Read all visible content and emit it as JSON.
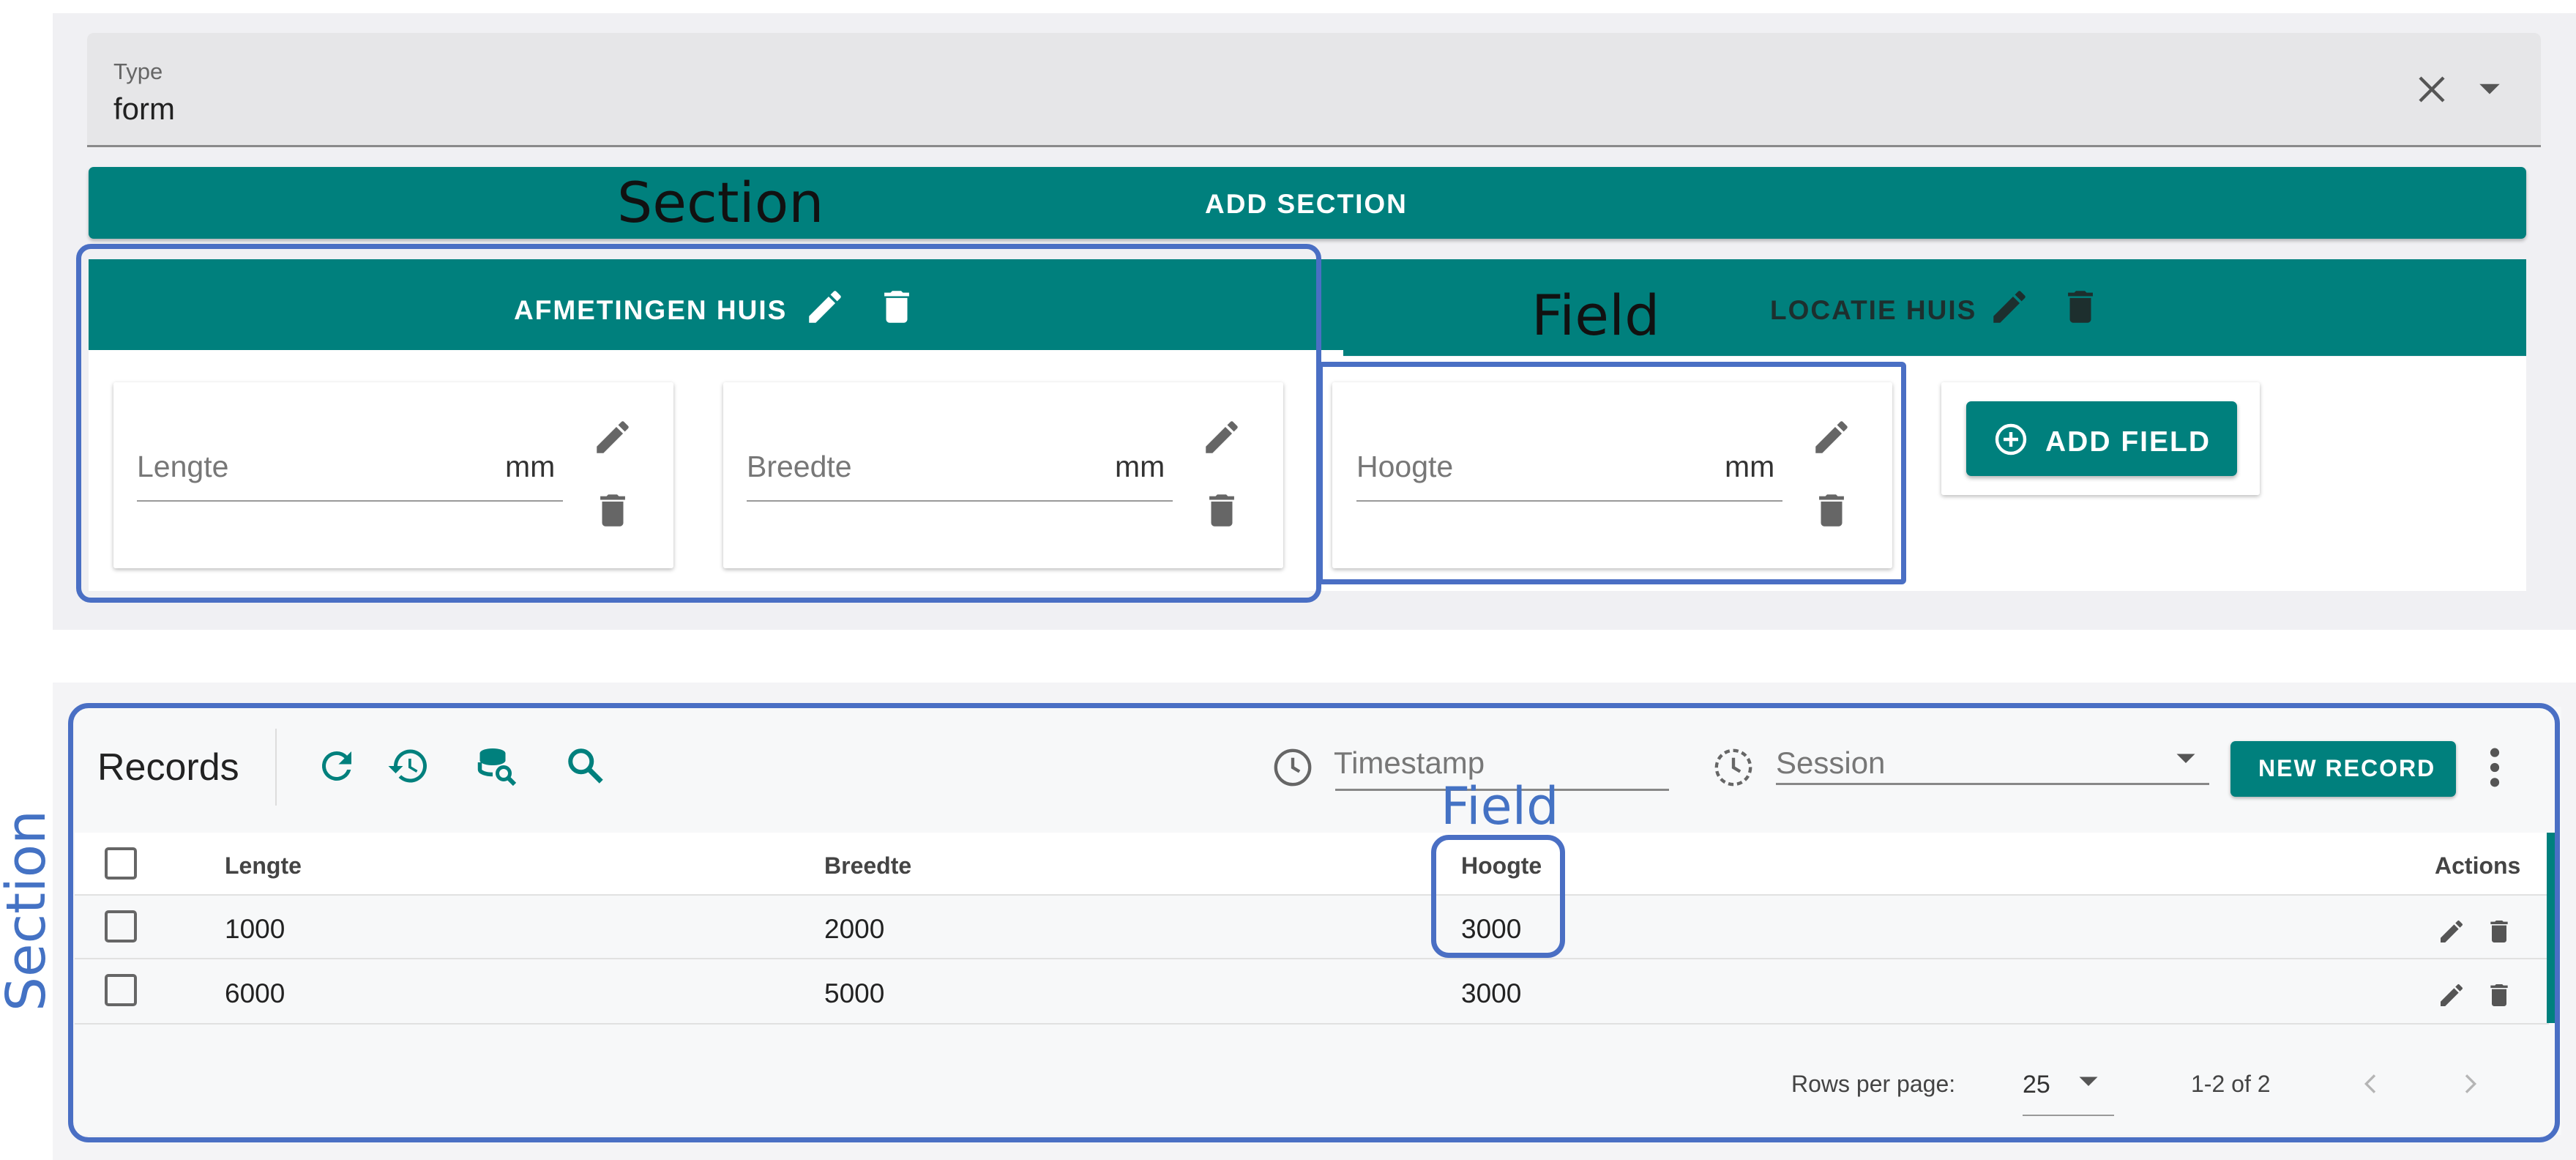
{
  "form_editor": {
    "type_field": {
      "label": "Type",
      "value": "form"
    },
    "add_section_label": "ADD SECTION",
    "sections": [
      {
        "label": "AFMETINGEN HUIS",
        "active": true
      },
      {
        "label": "LOCATIE HUIS",
        "active": false
      }
    ],
    "fields": [
      {
        "label": "Lengte",
        "unit": "mm"
      },
      {
        "label": "Breedte",
        "unit": "mm"
      },
      {
        "label": "Hoogte",
        "unit": "mm"
      }
    ],
    "add_field_label": "ADD FIELD"
  },
  "records": {
    "title": "Records",
    "toolbar_icons": [
      "refresh-icon",
      "history-icon",
      "database-search-icon",
      "search-icon"
    ],
    "filters": {
      "timestamp_placeholder": "Timestamp",
      "session_placeholder": "Session"
    },
    "new_record_label": "NEW RECORD",
    "columns": [
      "Lengte",
      "Breedte",
      "Hoogte"
    ],
    "actions_header": "Actions",
    "rows": [
      [
        "1000",
        "2000",
        "3000"
      ],
      [
        "6000",
        "5000",
        "3000"
      ]
    ],
    "pagination": {
      "rows_per_page_label": "Rows per page:",
      "rows_per_page": "25",
      "range": "1-2 of 2"
    }
  },
  "annotations": {
    "section_top": "Section",
    "field_top": "Field",
    "field_bottom": "Field",
    "section_side": "Section"
  },
  "colors": {
    "primary": "#00807d",
    "annotation": "#4a6fc4",
    "annotation_text": "#4472c4"
  }
}
